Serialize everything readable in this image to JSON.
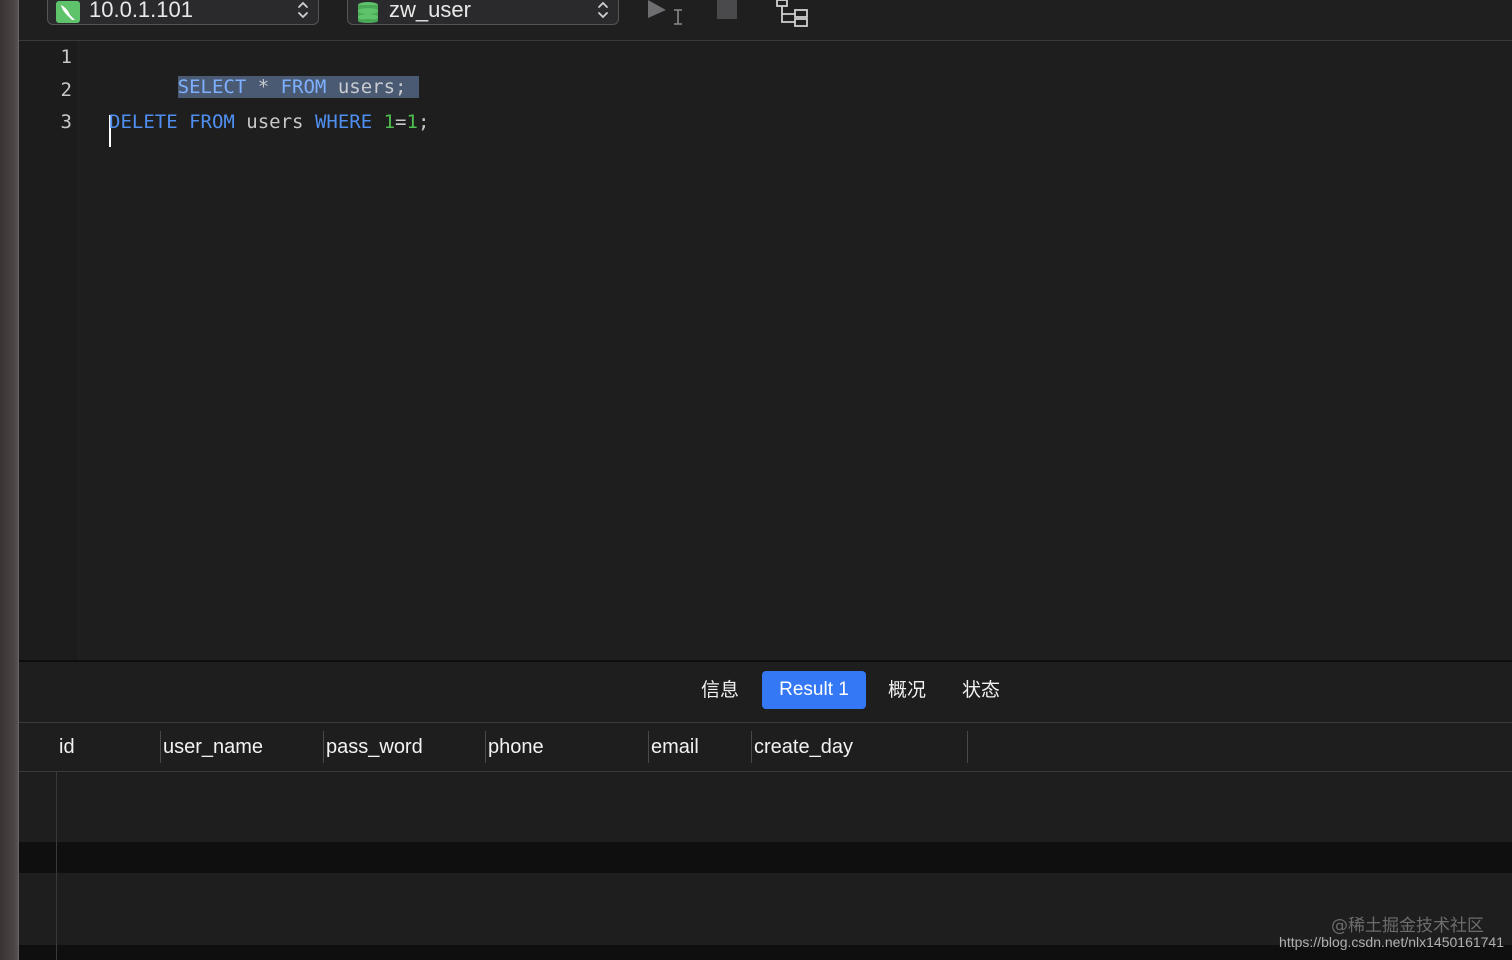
{
  "toolbar": {
    "host_selector": {
      "value": "10.0.1.101",
      "icon": "mysql-dolphin-icon"
    },
    "database_selector": {
      "value": "zw_user",
      "icon": "database-icon"
    },
    "run_icon": "run-play-icon",
    "stop_icon": "stop-icon",
    "explain_icon": "tree-structure-icon"
  },
  "editor": {
    "line_numbers": [
      "1",
      "2",
      "3"
    ],
    "lines": [
      {
        "kw1": "SELECT",
        "op": " * ",
        "kw2": "FROM",
        "rest": " users;"
      },
      {
        "text": ""
      },
      {
        "kw1": "DELETE",
        "sp1": " ",
        "kw2": "FROM",
        "sp2": " users ",
        "kw3": "WHERE",
        "sp3": " ",
        "n1": "1",
        "eq": "=",
        "n2": "1",
        "end": ";"
      }
    ]
  },
  "result_tabs": [
    {
      "label": "信息",
      "active": false
    },
    {
      "label": "Result 1",
      "active": true
    },
    {
      "label": "概况",
      "active": false
    },
    {
      "label": "状态",
      "active": false
    }
  ],
  "grid": {
    "columns": [
      "id",
      "user_name",
      "pass_word",
      "phone",
      "email",
      "create_day"
    ],
    "rows": []
  },
  "watermark": {
    "text": "@稀土掘金技术社区",
    "url": "https://blog.csdn.net/nlx1450161741"
  },
  "colors": {
    "keyword": "#4f8fef",
    "number": "#4fbf4f",
    "selection": "#4a5a73",
    "active_tab": "#3478f6",
    "background": "#1e1e1f"
  }
}
